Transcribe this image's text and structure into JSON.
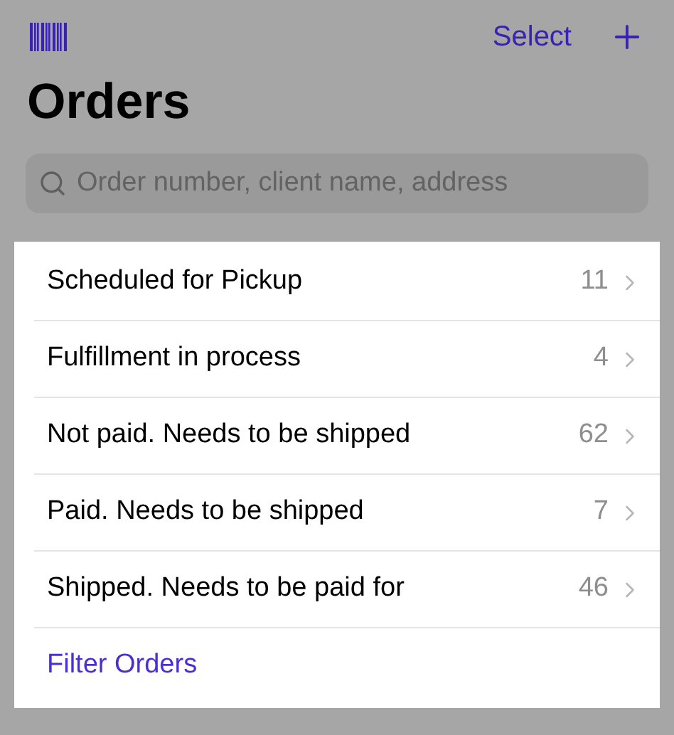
{
  "nav": {
    "select_label": "Select"
  },
  "title": "Orders",
  "search": {
    "placeholder": "Order number, client name, address"
  },
  "statuses": [
    {
      "label": "Scheduled for Pickup",
      "count": "11"
    },
    {
      "label": "Fulfillment in process",
      "count": "4"
    },
    {
      "label": "Not paid. Needs to be shipped",
      "count": "62"
    },
    {
      "label": "Paid. Needs to be shipped",
      "count": "7"
    },
    {
      "label": "Shipped. Needs to be paid for",
      "count": "46"
    }
  ],
  "filter_link": "Filter Orders"
}
